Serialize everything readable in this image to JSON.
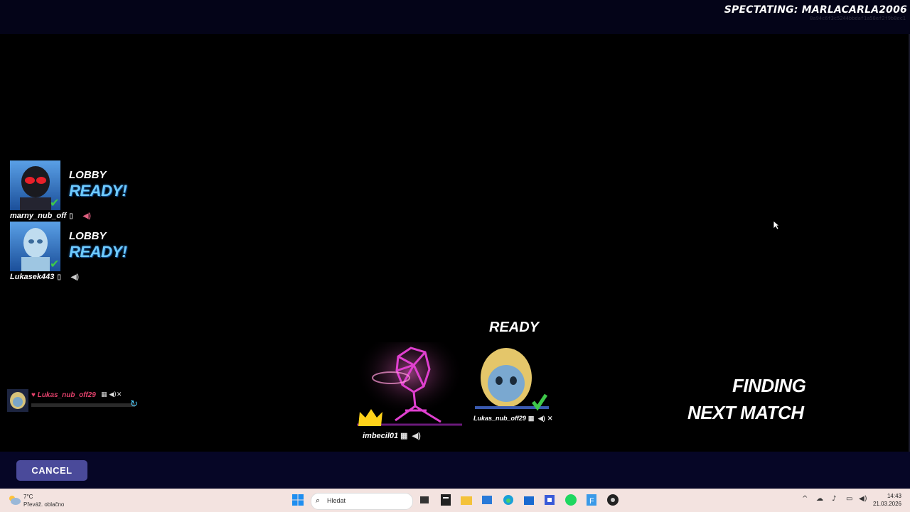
{
  "header": {
    "spectating_label": "SPECTATING: MARLACARLA2006",
    "spectating_id": "8a94c6f3c5244bbdaf1a58ef2f9b8ec1"
  },
  "party": [
    {
      "status": "LOBBY",
      "ready": "READY!",
      "name": "marny_nub_off"
    },
    {
      "status": "LOBBY",
      "ready": "READY!",
      "name": "Lukasek443"
    }
  ],
  "mini_player": {
    "name": "Lukas_nub_off29"
  },
  "squad": {
    "ready_label": "READY",
    "leader_name": "imbecil01",
    "member_name": "Lukas_nub_off29"
  },
  "status": {
    "line1": "FINDING",
    "line2": "NEXT MATCH"
  },
  "controls": {
    "cancel_label": "CANCEL"
  },
  "taskbar": {
    "temperature": "7°C",
    "condition": "Převáž. oblačno",
    "search_placeholder": "Hledat",
    "time": "14:43",
    "date": "21.03.2026"
  },
  "icons": {
    "check": "check-icon",
    "speaker": "speaker-icon",
    "mic_off": "mic-off-icon",
    "crown": "crown-icon",
    "spinner": "refresh-icon",
    "cursor": "mouse-cursor-icon"
  },
  "colors": {
    "ready_blue": "#6ecaff",
    "check_green": "#3ec84a",
    "cancel_button": "#4a4a9a",
    "mini_name": "#e0406a",
    "crown_yellow": "#ffd21a"
  }
}
